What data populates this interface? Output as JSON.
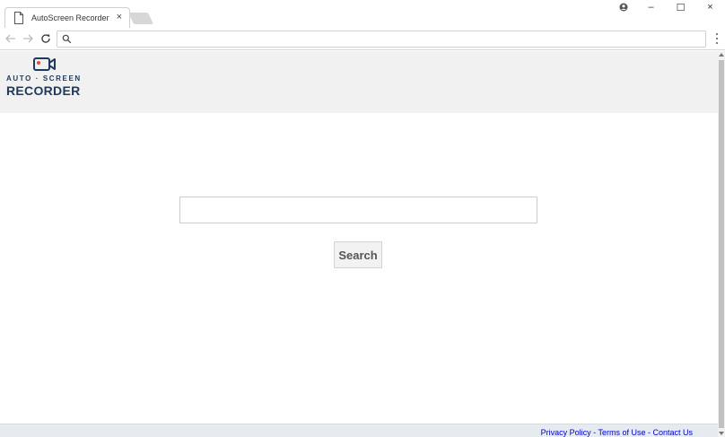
{
  "browser": {
    "tab": {
      "title": "AutoScreen Recorder",
      "close_glyph": "×",
      "icon": "page-icon"
    },
    "window_controls": {
      "minimize": "–",
      "maximize": "☐",
      "close": "×"
    },
    "omnibox": {
      "value": "",
      "icon": "search-icon"
    }
  },
  "site": {
    "logo": {
      "line1": "AUTO · SCREEN",
      "line2": "RECORDER",
      "icon": "camera-icon"
    },
    "search": {
      "value": "",
      "button_label": "Search"
    },
    "footer": {
      "privacy": "Privacy Policy",
      "terms": "Terms of Use",
      "contact": "Contact Us",
      "separator": " - "
    }
  },
  "colors": {
    "brand": "#1e3a5f",
    "camera_dot": "#e74c3c",
    "link": "#0000cc",
    "header_bg": "#f1f1f1"
  }
}
